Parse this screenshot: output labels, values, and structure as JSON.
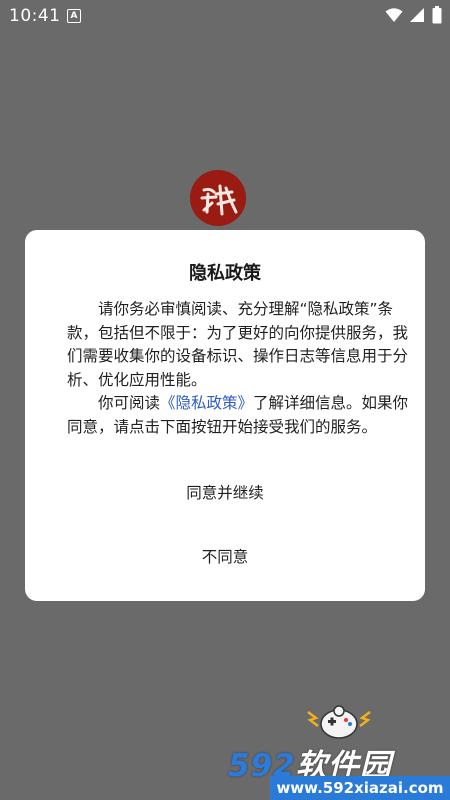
{
  "status_bar": {
    "time": "10:41",
    "notification_icon": "a-icon",
    "wifi_icon": "wifi-icon",
    "signal_icon": "signal-icon",
    "battery_icon": "battery-icon"
  },
  "app_logo": {
    "icon": "app-logo-red-circle",
    "color": "#9a1b12"
  },
  "dialog": {
    "title": "隐私政策",
    "paragraph1": "请你务必审慎阅读、充分理解“隐私政策”条款，包括但不限于：为了更好的向你提供服务，我们需要收集你的设备标识、操作日志等信息用于分析、优化应用性能。",
    "paragraph2_before": "你可阅读",
    "policy_link": "《隐私政策》",
    "paragraph2_after": "了解详细信息。如果你同意，请点击下面按钮开始接受我们的服务。",
    "agree_label": "同意并继续",
    "disagree_label": "不同意",
    "link_color": "#2f5cc6"
  },
  "watermark": {
    "brand_num": "592",
    "brand_text": "软件园",
    "url": "www.592xiazai.com",
    "mascot_icon": "game-controller-mascot-icon",
    "accent": "#2a7ad8"
  }
}
